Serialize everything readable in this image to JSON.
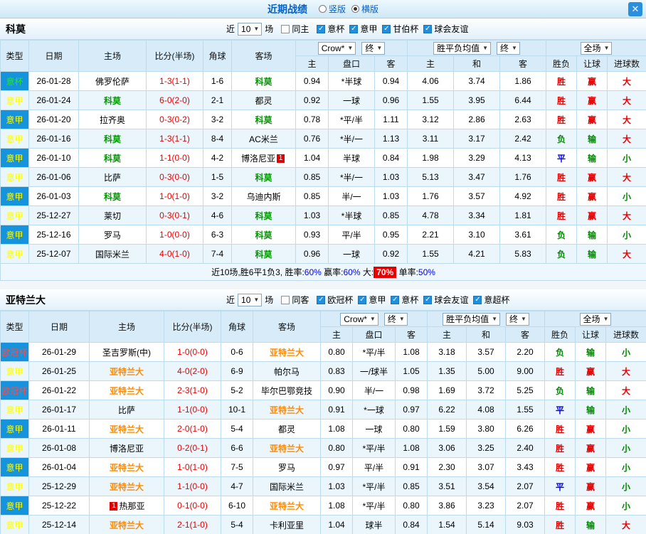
{
  "titlebar": {
    "title": "近期战绩",
    "radios": [
      {
        "label": "竖版",
        "selected": false
      },
      {
        "label": "横版",
        "selected": true
      }
    ],
    "close_label": "✕"
  },
  "columns": {
    "type": "类型",
    "date": "日期",
    "home": "主场",
    "score": "比分(半场)",
    "corner": "角球",
    "away": "客场",
    "odds_source": "Crow*",
    "odds_final": "终",
    "avg_label": "胜平负均值",
    "avg_final": "终",
    "scope": "全场",
    "sub": [
      "主",
      "盘口",
      "客",
      "主",
      "和",
      "客",
      "胜负",
      "让球",
      "进球数"
    ],
    "dropdown_arrow": "▼"
  },
  "type_colors": {
    "意杯": "#22e632",
    "意甲": "#ffff00",
    "欧冠杯": "#ff4a4a"
  },
  "verdict_colors": {
    "胜": "#e80000",
    "平": "#0000e8",
    "负": "#008800",
    "赢": "#e80000",
    "输": "#008800",
    "大": "#e80000",
    "小": "#008800"
  },
  "teams": [
    {
      "name": "科莫",
      "hl_color": "#009900",
      "filters": {
        "near": "近",
        "count": "10",
        "games": "场",
        "same": {
          "label": "同主",
          "checked": false
        },
        "comps": [
          {
            "label": "意杯",
            "checked": true
          },
          {
            "label": "意甲",
            "checked": true
          },
          {
            "label": "甘伯杯",
            "checked": true
          },
          {
            "label": "球会友谊",
            "checked": true
          }
        ]
      },
      "rows": [
        {
          "type": "意杯",
          "date": "26-01-28",
          "home": "佛罗伦萨",
          "score": "1-3(1-1)",
          "corner": "1-6",
          "away": "科莫",
          "away_hl": true,
          "odds": [
            "0.94",
            "*半球",
            "0.94"
          ],
          "avg": [
            "4.06",
            "3.74",
            "1.86"
          ],
          "result": "胜",
          "handicap": "赢",
          "goals": "大"
        },
        {
          "type": "意甲",
          "date": "26-01-24",
          "home": "科莫",
          "home_hl": true,
          "score": "6-0(2-0)",
          "corner": "2-1",
          "away": "都灵",
          "odds": [
            "0.92",
            "一球",
            "0.96"
          ],
          "avg": [
            "1.55",
            "3.95",
            "6.44"
          ],
          "result": "胜",
          "handicap": "赢",
          "goals": "大"
        },
        {
          "type": "意甲",
          "date": "26-01-20",
          "home": "拉齐奥",
          "score": "0-3(0-2)",
          "corner": "3-2",
          "away": "科莫",
          "away_hl": true,
          "odds": [
            "0.78",
            "*平/半",
            "1.11"
          ],
          "avg": [
            "3.12",
            "2.86",
            "2.63"
          ],
          "result": "胜",
          "handicap": "赢",
          "goals": "大"
        },
        {
          "type": "意甲",
          "date": "26-01-16",
          "home": "科莫",
          "home_hl": true,
          "score": "1-3(1-1)",
          "corner": "8-4",
          "away": "AC米兰",
          "odds": [
            "0.76",
            "*半/一",
            "1.13"
          ],
          "avg": [
            "3.11",
            "3.17",
            "2.42"
          ],
          "result": "负",
          "handicap": "输",
          "goals": "大"
        },
        {
          "type": "意甲",
          "date": "26-01-10",
          "home": "科莫",
          "home_hl": true,
          "score": "1-1(0-0)",
          "corner": "4-2",
          "away": "博洛尼亚",
          "away_badge": "1",
          "odds": [
            "1.04",
            "半球",
            "0.84"
          ],
          "avg": [
            "1.98",
            "3.29",
            "4.13"
          ],
          "result": "平",
          "handicap": "输",
          "goals": "小"
        },
        {
          "type": "意甲",
          "date": "26-01-06",
          "home": "比萨",
          "score": "0-3(0-0)",
          "corner": "1-5",
          "away": "科莫",
          "away_hl": true,
          "odds": [
            "0.85",
            "*半/一",
            "1.03"
          ],
          "avg": [
            "5.13",
            "3.47",
            "1.76"
          ],
          "result": "胜",
          "handicap": "赢",
          "goals": "大"
        },
        {
          "type": "意甲",
          "date": "26-01-03",
          "home": "科莫",
          "home_hl": true,
          "score": "1-0(1-0)",
          "corner": "3-2",
          "away": "乌迪内斯",
          "odds": [
            "0.85",
            "半/一",
            "1.03"
          ],
          "avg": [
            "1.76",
            "3.57",
            "4.92"
          ],
          "result": "胜",
          "handicap": "赢",
          "goals": "小"
        },
        {
          "type": "意甲",
          "date": "25-12-27",
          "home": "莱切",
          "score": "0-3(0-1)",
          "corner": "4-6",
          "away": "科莫",
          "away_hl": true,
          "odds": [
            "1.03",
            "*半球",
            "0.85"
          ],
          "avg": [
            "4.78",
            "3.34",
            "1.81"
          ],
          "result": "胜",
          "handicap": "赢",
          "goals": "大"
        },
        {
          "type": "意甲",
          "date": "25-12-16",
          "home": "罗马",
          "score": "1-0(0-0)",
          "corner": "6-3",
          "away": "科莫",
          "away_hl": true,
          "odds": [
            "0.93",
            "平/半",
            "0.95"
          ],
          "avg": [
            "2.21",
            "3.10",
            "3.61"
          ],
          "result": "负",
          "handicap": "输",
          "goals": "小"
        },
        {
          "type": "意甲",
          "date": "25-12-07",
          "home": "国际米兰",
          "score": "4-0(1-0)",
          "corner": "7-4",
          "away": "科莫",
          "away_hl": true,
          "odds": [
            "0.96",
            "一球",
            "0.92"
          ],
          "avg": [
            "1.55",
            "4.21",
            "5.83"
          ],
          "result": "负",
          "handicap": "输",
          "goals": "大"
        }
      ],
      "summary": [
        {
          "text": "近10场,胜6平1负3, ",
          "style": "plain"
        },
        {
          "text": "胜率:",
          "style": "plain"
        },
        {
          "text": "60%",
          "style": "blue"
        },
        {
          "text": " 赢率:",
          "style": "plain"
        },
        {
          "text": "60%",
          "style": "blue"
        },
        {
          "text": " 大:",
          "style": "plain"
        },
        {
          "text": "70%",
          "style": "redbg"
        },
        {
          "text": " 单率:",
          "style": "plain"
        },
        {
          "text": "50%",
          "style": "blue"
        }
      ]
    },
    {
      "name": "亚特兰大",
      "hl_color": "#ff8a00",
      "filters": {
        "near": "近",
        "count": "10",
        "games": "场",
        "same": {
          "label": "同客",
          "checked": false
        },
        "comps": [
          {
            "label": "欧冠杯",
            "checked": true
          },
          {
            "label": "意甲",
            "checked": true
          },
          {
            "label": "意杯",
            "checked": true
          },
          {
            "label": "球会友谊",
            "checked": true
          },
          {
            "label": "意超杯",
            "checked": true
          }
        ]
      },
      "rows": [
        {
          "type": "欧冠杯",
          "date": "26-01-29",
          "home": "圣吉罗斯(中)",
          "score": "1-0(0-0)",
          "corner": "0-6",
          "away": "亚特兰大",
          "away_hl": true,
          "odds": [
            "0.80",
            "*平/半",
            "1.08"
          ],
          "avg": [
            "3.18",
            "3.57",
            "2.20"
          ],
          "result": "负",
          "handicap": "输",
          "goals": "小"
        },
        {
          "type": "意甲",
          "date": "26-01-25",
          "home": "亚特兰大",
          "home_hl": true,
          "score": "4-0(2-0)",
          "corner": "6-9",
          "away": "帕尔马",
          "odds": [
            "0.83",
            "一/球半",
            "1.05"
          ],
          "avg": [
            "1.35",
            "5.00",
            "9.00"
          ],
          "result": "胜",
          "handicap": "赢",
          "goals": "大"
        },
        {
          "type": "欧冠杯",
          "date": "26-01-22",
          "home": "亚特兰大",
          "home_hl": true,
          "score": "2-3(1-0)",
          "corner": "5-2",
          "away": "毕尔巴鄂竞技",
          "odds": [
            "0.90",
            "半/一",
            "0.98"
          ],
          "avg": [
            "1.69",
            "3.72",
            "5.25"
          ],
          "result": "负",
          "handicap": "输",
          "goals": "大"
        },
        {
          "type": "意甲",
          "date": "26-01-17",
          "home": "比萨",
          "score": "1-1(0-0)",
          "corner": "10-1",
          "away": "亚特兰大",
          "away_hl": true,
          "odds": [
            "0.91",
            "*一球",
            "0.97"
          ],
          "avg": [
            "6.22",
            "4.08",
            "1.55"
          ],
          "result": "平",
          "handicap": "输",
          "goals": "小"
        },
        {
          "type": "意甲",
          "date": "26-01-11",
          "home": "亚特兰大",
          "home_hl": true,
          "score": "2-0(1-0)",
          "corner": "5-4",
          "away": "都灵",
          "odds": [
            "1.08",
            "一球",
            "0.80"
          ],
          "avg": [
            "1.59",
            "3.80",
            "6.26"
          ],
          "result": "胜",
          "handicap": "赢",
          "goals": "小"
        },
        {
          "type": "意甲",
          "date": "26-01-08",
          "home": "博洛尼亚",
          "score": "0-2(0-1)",
          "corner": "6-6",
          "away": "亚特兰大",
          "away_hl": true,
          "odds": [
            "0.80",
            "*平/半",
            "1.08"
          ],
          "avg": [
            "3.06",
            "3.25",
            "2.40"
          ],
          "result": "胜",
          "handicap": "赢",
          "goals": "小"
        },
        {
          "type": "意甲",
          "date": "26-01-04",
          "home": "亚特兰大",
          "home_hl": true,
          "score": "1-0(1-0)",
          "corner": "7-5",
          "away": "罗马",
          "odds": [
            "0.97",
            "平/半",
            "0.91"
          ],
          "avg": [
            "2.30",
            "3.07",
            "3.43"
          ],
          "result": "胜",
          "handicap": "赢",
          "goals": "小"
        },
        {
          "type": "意甲",
          "date": "25-12-29",
          "home": "亚特兰大",
          "home_hl": true,
          "score": "1-1(0-0)",
          "corner": "4-7",
          "away": "国际米兰",
          "odds": [
            "1.03",
            "*平/半",
            "0.85"
          ],
          "avg": [
            "3.51",
            "3.54",
            "2.07"
          ],
          "result": "平",
          "handicap": "赢",
          "goals": "小"
        },
        {
          "type": "意甲",
          "date": "25-12-22",
          "home": "热那亚",
          "home_badge": "1",
          "score": "0-1(0-0)",
          "corner": "6-10",
          "away": "亚特兰大",
          "away_hl": true,
          "odds": [
            "1.08",
            "*平/半",
            "0.80"
          ],
          "avg": [
            "3.86",
            "3.23",
            "2.07"
          ],
          "result": "胜",
          "handicap": "赢",
          "goals": "小"
        },
        {
          "type": "意甲",
          "date": "25-12-14",
          "home": "亚特兰大",
          "home_hl": true,
          "score": "2-1(1-0)",
          "corner": "5-4",
          "away": "卡利亚里",
          "odds": [
            "1.04",
            "球半",
            "0.84"
          ],
          "avg": [
            "1.54",
            "5.14",
            "9.03"
          ],
          "result": "胜",
          "handicap": "输",
          "goals": "大"
        }
      ]
    }
  ]
}
